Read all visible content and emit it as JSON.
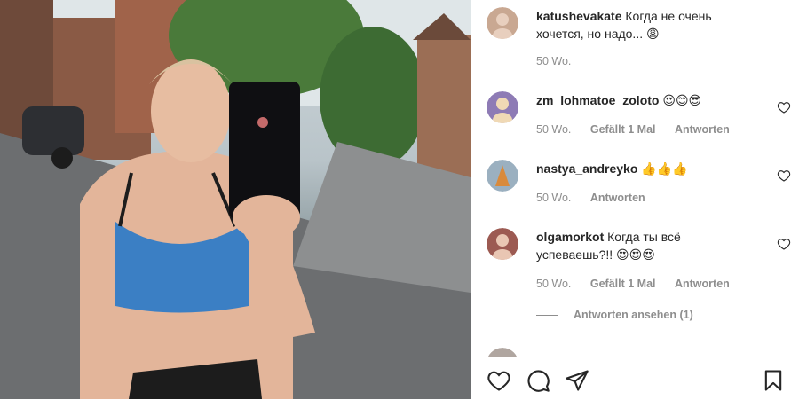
{
  "comments": [
    {
      "user": "katushevakate",
      "text": "Когда не очень хочется, но надо...",
      "emoji": "😩",
      "time": "50 Wo.",
      "avatar_color": "#c9a892"
    },
    {
      "user": "zm_lohmatoe_zoloto",
      "text": "",
      "emoji": "😍😊😎",
      "time": "50 Wo.",
      "likes": "Gefällt 1 Mal",
      "reply": "Antworten",
      "avatar_color": "#8e7bb5"
    },
    {
      "user": "nastya_andreyko",
      "text": "",
      "emoji": "👍👍👍",
      "time": "50 Wo.",
      "reply": "Antworten",
      "avatar_color": "#d98a3b"
    },
    {
      "user": "olgamorkot",
      "text": "Когда ты всё успеваешь?!!",
      "emoji": "😍😍😍",
      "time": "50 Wo.",
      "likes": "Gefällt 1 Mal",
      "reply": "Antworten",
      "avatar_color": "#9c5a52"
    }
  ],
  "view_replies": "Antworten ansehen (1)",
  "icons": {
    "like": "heart-icon",
    "comment": "comment-icon",
    "share": "share-icon",
    "save": "bookmark-icon"
  }
}
